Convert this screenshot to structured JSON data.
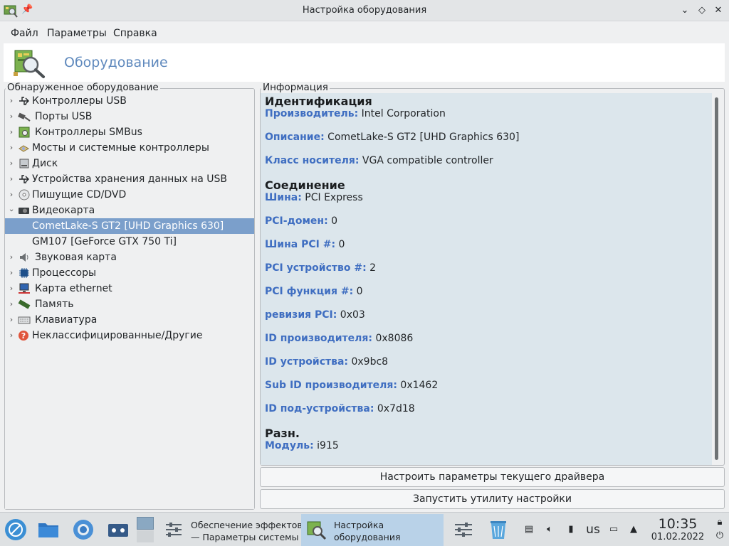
{
  "window": {
    "title": "Настройка оборудования"
  },
  "menubar": {
    "items": [
      "Файл",
      "Параметры",
      "Справка"
    ]
  },
  "header": {
    "title": "Оборудование"
  },
  "left": {
    "group_label": "Обнаруженное оборудование",
    "tree": [
      {
        "label": "Контроллеры USB",
        "icon": "usb-icon",
        "expanded": false
      },
      {
        "label": "Порты USB",
        "icon": "usb-plug-icon",
        "expanded": false
      },
      {
        "label": "Контроллеры SMBus",
        "icon": "smbus-icon",
        "expanded": false
      },
      {
        "label": "Мосты и системные контроллеры",
        "icon": "bridge-icon",
        "expanded": false
      },
      {
        "label": "Диск",
        "icon": "disk-icon",
        "expanded": false
      },
      {
        "label": "Устройства хранения данных на USB",
        "icon": "usb-icon",
        "expanded": false
      },
      {
        "label": "Пишущие CD/DVD",
        "icon": "cd-icon",
        "expanded": false
      },
      {
        "label": "Видеокарта",
        "icon": "video-card-icon",
        "expanded": true
      },
      {
        "label": "CometLake-S GT2 [UHD Graphics 630]",
        "child": true,
        "selected": true
      },
      {
        "label": "GM107 [GeForce GTX 750 Ti]",
        "child": true
      },
      {
        "label": "Звуковая карта",
        "icon": "speaker-icon",
        "expanded": false
      },
      {
        "label": "Процессоры",
        "icon": "cpu-icon",
        "expanded": false
      },
      {
        "label": "Карта ethernet",
        "icon": "network-icon",
        "expanded": false
      },
      {
        "label": "Память",
        "icon": "memory-icon",
        "expanded": false
      },
      {
        "label": "Клавиатура",
        "icon": "keyboard-icon",
        "expanded": false
      },
      {
        "label": "Неклассифицированные/Другие",
        "icon": "question-icon",
        "expanded": false
      }
    ]
  },
  "right": {
    "group_label": "Информация",
    "sections": [
      {
        "title": "Идентификация",
        "fields": [
          {
            "key": "Производитель:",
            "value": "Intel Corporation"
          },
          {
            "key": "Описание:",
            "value": "CometLake-S GT2 [UHD Graphics 630]"
          },
          {
            "key": "Класс носителя:",
            "value": "VGA compatible controller"
          }
        ]
      },
      {
        "title": "Соединение",
        "fields": [
          {
            "key": "Шина:",
            "value": "PCI Express"
          },
          {
            "key": "PCI-домен:",
            "value": "0"
          },
          {
            "key": "Шина PCI #:",
            "value": "0"
          },
          {
            "key": "PCI устройство #:",
            "value": "2"
          },
          {
            "key": "PCI функция #:",
            "value": "0"
          },
          {
            "key": "ревизия PCI:",
            "value": "0x03"
          },
          {
            "key": "ID производителя:",
            "value": "0x8086"
          },
          {
            "key": "ID устройства:",
            "value": "0x9bc8"
          },
          {
            "key": "Sub ID производителя:",
            "value": "0x1462"
          },
          {
            "key": "ID под-устройства:",
            "value": "0x7d18"
          }
        ]
      },
      {
        "title": "Разн.",
        "fields": [
          {
            "key": "Модуль:",
            "value": "i915"
          }
        ]
      }
    ],
    "buttons": {
      "configure_driver": "Настроить параметры текущего драйвера",
      "run_utility": "Запустить утилиту настройки"
    }
  },
  "taskbar": {
    "tasks": [
      {
        "label": "Обеспечение эффектов\n— Параметры системы",
        "active": false
      },
      {
        "label": "Настройка\nоборудования",
        "active": true
      }
    ],
    "tray": {
      "keyboard_layout": "us"
    },
    "clock": {
      "time": "10:35",
      "date": "01.02.2022"
    }
  },
  "colors": {
    "accent": "#5f89bd",
    "selection": "#7b9fcb",
    "field_key": "#3f6ec1",
    "info_bg": "#dce6ec"
  }
}
